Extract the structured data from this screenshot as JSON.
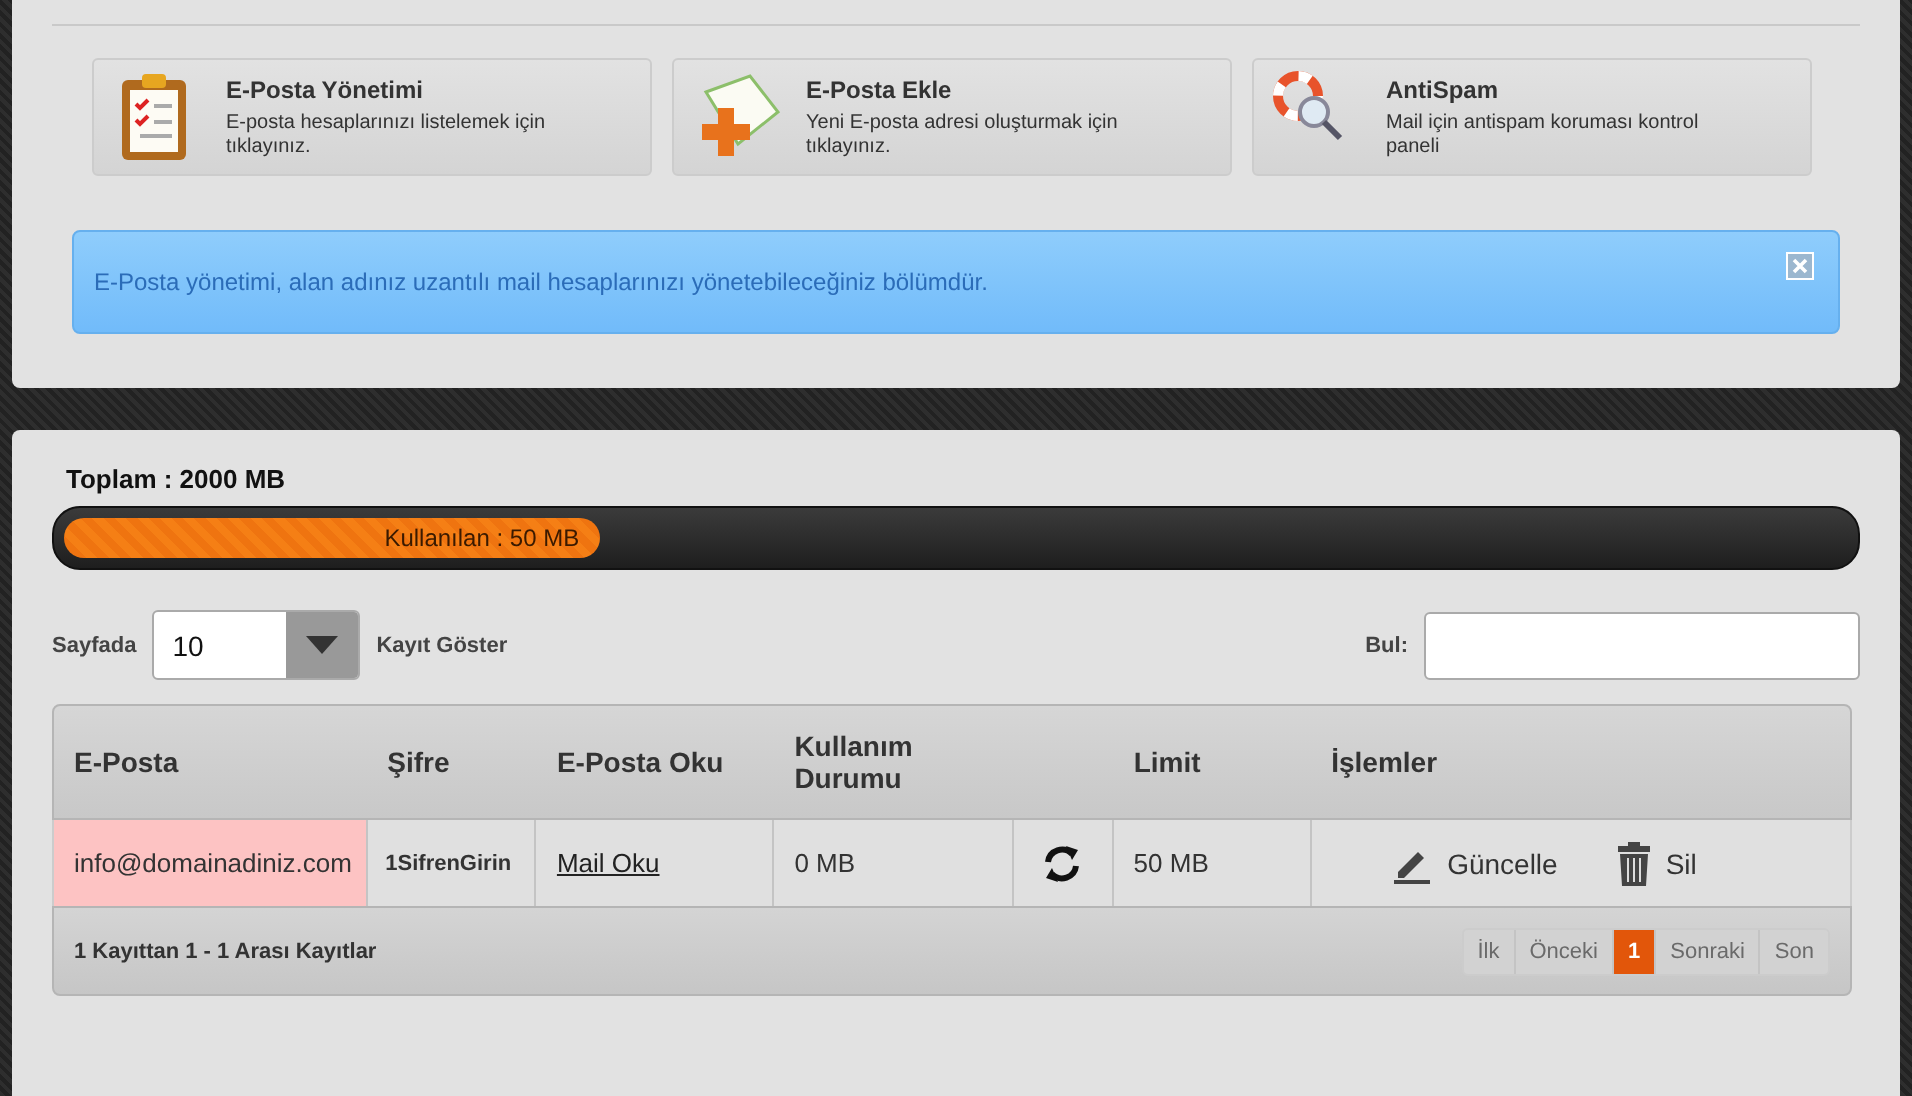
{
  "shortcuts": [
    {
      "kind": "clipboard",
      "title": "E-Posta Yönetimi",
      "desc": "E-posta hesaplarınızı listelemek için tıklayınız."
    },
    {
      "kind": "add",
      "title": "E-Posta Ekle",
      "desc": "Yeni E-posta adresi oluşturmak için tıklayınız."
    },
    {
      "kind": "lifebuoy",
      "title": "AntiSpam",
      "desc": "Mail için antispam koruması kontrol paneli"
    }
  ],
  "notice": {
    "text": "E-Posta yönetimi, alan adınız uzantılı mail hesaplarınızı yönetebileceğiniz bölümdür."
  },
  "usage": {
    "total": "Toplam : 2000 MB",
    "used": "Kullanılan : 50 MB",
    "level": 0.3
  },
  "page_size": {
    "label": "Sayfada",
    "value": "10",
    "suffix": "Kayıt Göster"
  },
  "search": {
    "label": "Bul:"
  },
  "table": {
    "columns": [
      "E-Posta",
      "Şifre",
      "E-Posta Oku",
      "Kullanım Durumu",
      "Limit",
      "İşlemler"
    ],
    "rows": [
      {
        "email": "info@domainadiniz.com",
        "password": "1SifrenGirin",
        "read": "Mail Oku",
        "usage": "0 MB",
        "limit": "50 MB",
        "actions": [
          {
            "kind": "edit",
            "label": "Güncelle"
          },
          {
            "kind": "delete",
            "label": "Sil"
          }
        ]
      }
    ]
  },
  "footer": {
    "info": "1 Kayıttan 1 - 1 Arası Kayıtlar",
    "pages": [
      {
        "label": "İlk",
        "selected": false
      },
      {
        "label": "Önceki",
        "selected": false
      },
      {
        "label": "1",
        "selected": true
      },
      {
        "label": "Sonraki",
        "selected": false
      },
      {
        "label": "Son",
        "selected": false
      }
    ]
  }
}
